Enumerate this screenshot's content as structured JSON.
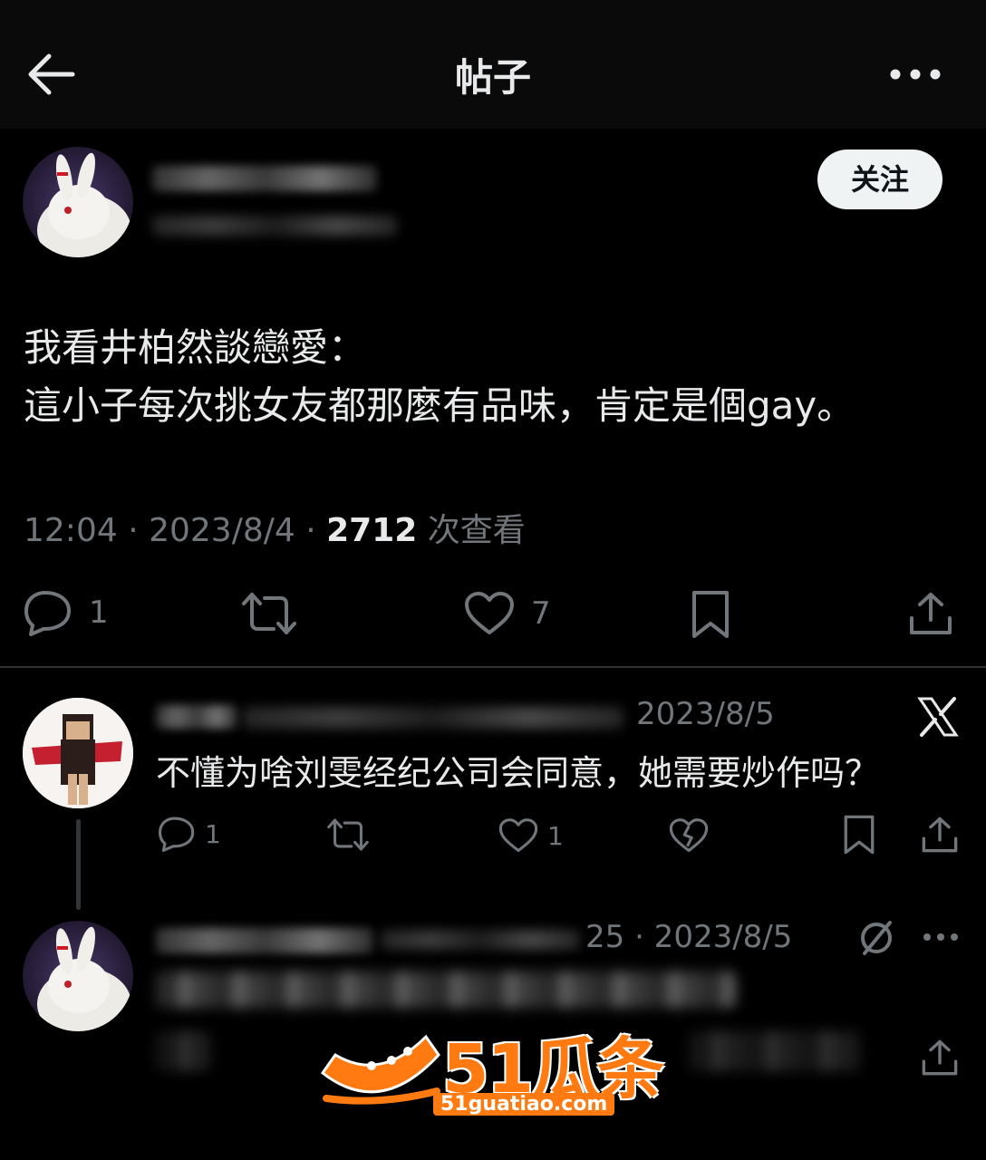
{
  "header": {
    "title": "帖子"
  },
  "post": {
    "follow_label": "关注",
    "body_line1": "我看井柏然談戀愛：",
    "body_line2": "這小子每次挑女友都那麼有品味，肯定是個gay。",
    "time": "12:04",
    "date": "2023/8/4",
    "views": "2712",
    "views_label": "次查看",
    "reply_count": "1",
    "like_count": "7"
  },
  "reply1": {
    "date": "2023/8/5",
    "text": "不懂为啥刘雯经纪公司会同意，她需要炒作吗？",
    "reply_count": "1",
    "like_count": "1"
  },
  "reply2": {
    "date_partial": "25 · 2023/8/5"
  },
  "watermark": {
    "main": "51瓜条",
    "sub": "51guatiao.com"
  },
  "colors": {
    "background": "#000000",
    "text": "#e7e9ea",
    "muted": "#71767b",
    "accent": "#ff7a10"
  }
}
